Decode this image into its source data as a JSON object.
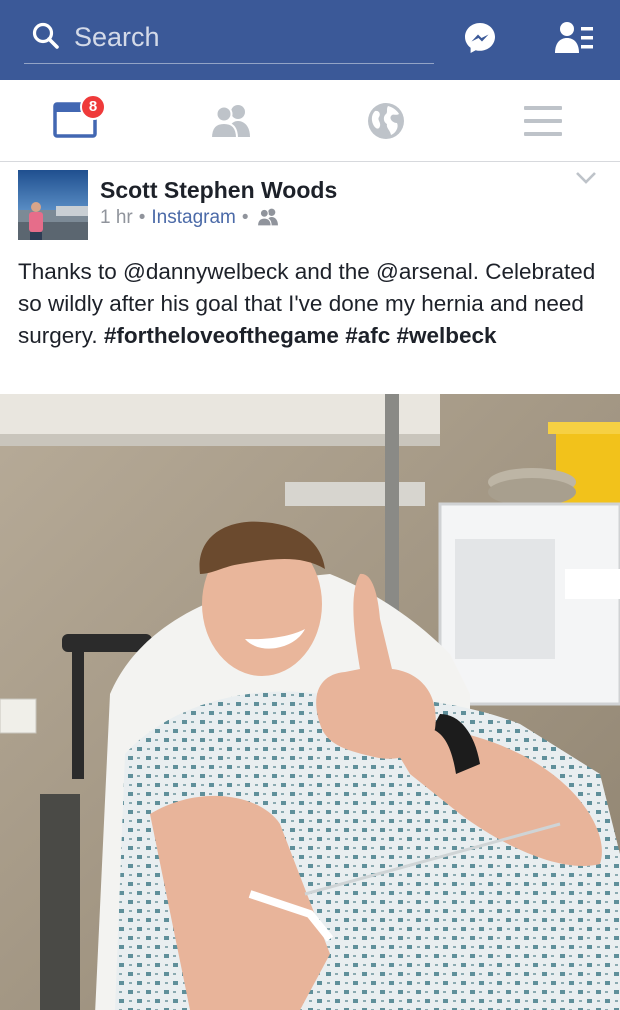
{
  "search": {
    "placeholder": "Search",
    "icon": "search-icon"
  },
  "topbar": {
    "background": "#3b5998",
    "messenger_icon": "messenger-icon",
    "friend_requests_icon": "friend-requests-icon"
  },
  "nav": {
    "tabs": [
      {
        "name": "news-feed",
        "icon": "news-feed-icon",
        "active": true,
        "badge": "8"
      },
      {
        "name": "friends",
        "icon": "friends-icon",
        "active": false
      },
      {
        "name": "notifications",
        "icon": "globe-icon",
        "active": false
      },
      {
        "name": "menu",
        "icon": "hamburger-icon",
        "active": false
      }
    ],
    "active_color": "#4267b2",
    "inactive_color": "#bec3c9",
    "badge_color": "#ef3a3a"
  },
  "post": {
    "author": "Scott Stephen Woods",
    "time": "1 hr",
    "source": "Instagram",
    "audience_icon": "friends-audience-icon",
    "text_plain": "Thanks to @dannywelbeck and the @arsenal. Celebrated so wildly after his goal that I've done my hernia and need surgery.",
    "hashtags": [
      "#fortheloveofthegame",
      "#afc",
      "#welbeck"
    ],
    "photo_description_icon": "hospital-bed-photo"
  }
}
